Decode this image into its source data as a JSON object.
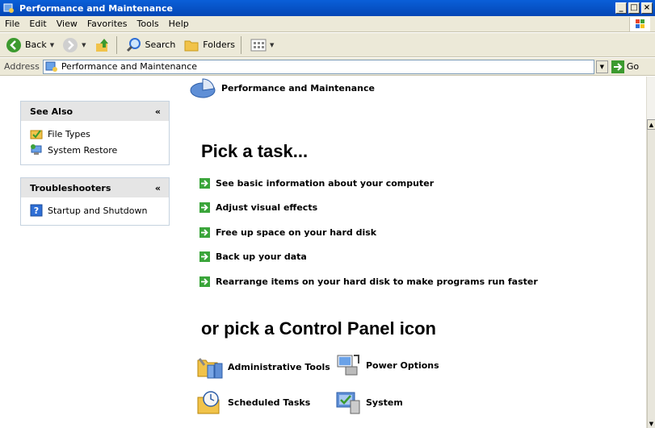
{
  "window": {
    "title": "Performance and Maintenance",
    "minimize": "_",
    "maximize": "□",
    "close": "×"
  },
  "menu": [
    "File",
    "Edit",
    "View",
    "Favorites",
    "Tools",
    "Help"
  ],
  "toolbar": {
    "back_label": "Back",
    "search_label": "Search",
    "folders_label": "Folders"
  },
  "address": {
    "label": "Address",
    "value": "Performance and Maintenance",
    "go_label": "Go"
  },
  "sidebar": {
    "see_also": {
      "title": "See Also",
      "items": [
        "File Types",
        "System Restore"
      ]
    },
    "troubleshooters": {
      "title": "Troubleshooters",
      "items": [
        "Startup and Shutdown"
      ]
    }
  },
  "main": {
    "category_title": "Performance and Maintenance",
    "pick_task_heading": "Pick a task...",
    "tasks": [
      "See basic information about your computer",
      "Adjust visual effects",
      "Free up space on your hard disk",
      "Back up your data",
      "Rearrange items on your hard disk to make programs run faster"
    ],
    "pick_icon_heading": "or pick a Control Panel icon",
    "icons": [
      "Administrative Tools",
      "Power Options",
      "Scheduled Tasks",
      "System"
    ]
  },
  "colors": {
    "title_bar": "#0a5fd8",
    "chrome": "#ece9d8",
    "task_arrow": "#3aa53a",
    "panel_header": "#e5e5e5"
  }
}
